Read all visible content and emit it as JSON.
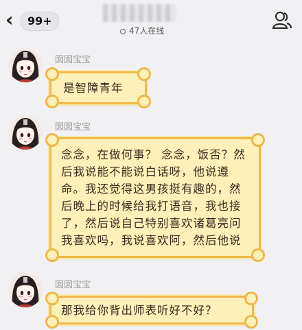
{
  "header": {
    "unread_count": "99+",
    "online_text": "47人在线"
  },
  "messages": [
    {
      "sender": "囡囡宝宝",
      "text": "是智障青年"
    },
    {
      "sender": "囡囡宝宝",
      "text": "念念，在做何事？ 念念，饭否？然后我说能不能说白话呀，他说遵命。我还觉得这男孩挺有趣的，然后晚上的时候给我打语音，我也接了，然后说自己特别喜欢诸葛亮问我喜欢吗，我说喜欢阿，然后他说"
    },
    {
      "sender": "囡囡宝宝",
      "text": "那我给你背出师表听好不好？"
    }
  ],
  "colors": {
    "bubble_bg": "#fdf0b9",
    "bubble_border": "#efb84a",
    "page_bg": "#f1f1f4"
  },
  "icons": {
    "back": "chevron-left-icon",
    "profile": "two-person-icon",
    "online": "circle-icon"
  }
}
